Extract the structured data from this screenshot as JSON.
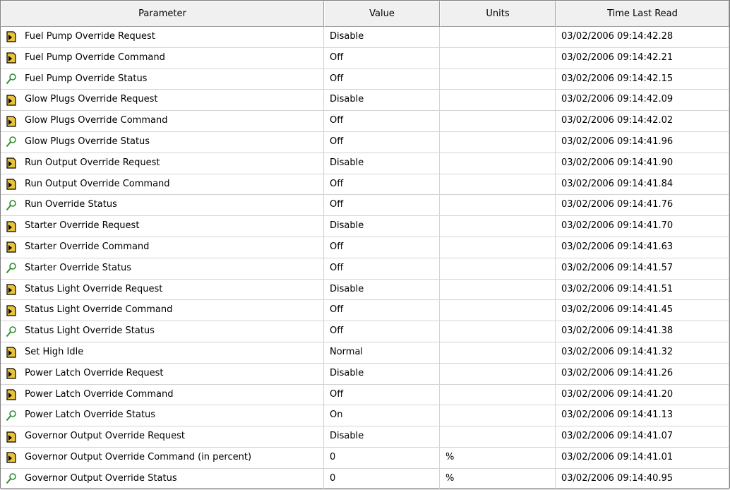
{
  "columns": {
    "parameter": "Parameter",
    "value": "Value",
    "units": "Units",
    "time": "Time Last Read"
  },
  "rows": [
    {
      "icon": "write-icon",
      "parameter": "Fuel Pump Override Request",
      "value": "Disable",
      "units": "",
      "time": "03/02/2006 09:14:42.28"
    },
    {
      "icon": "write-icon",
      "parameter": "Fuel Pump Override Command",
      "value": "Off",
      "units": "",
      "time": "03/02/2006 09:14:42.21"
    },
    {
      "icon": "read-icon",
      "parameter": "Fuel Pump Override Status",
      "value": "Off",
      "units": "",
      "time": "03/02/2006 09:14:42.15"
    },
    {
      "icon": "write-icon",
      "parameter": "Glow Plugs Override Request",
      "value": "Disable",
      "units": "",
      "time": "03/02/2006 09:14:42.09"
    },
    {
      "icon": "write-icon",
      "parameter": "Glow Plugs Override Command",
      "value": "Off",
      "units": "",
      "time": "03/02/2006 09:14:42.02"
    },
    {
      "icon": "read-icon",
      "parameter": "Glow Plugs Override Status",
      "value": "Off",
      "units": "",
      "time": "03/02/2006 09:14:41.96"
    },
    {
      "icon": "write-icon",
      "parameter": "Run Output Override Request",
      "value": "Disable",
      "units": "",
      "time": "03/02/2006 09:14:41.90"
    },
    {
      "icon": "write-icon",
      "parameter": "Run Output Override Command",
      "value": "Off",
      "units": "",
      "time": "03/02/2006 09:14:41.84"
    },
    {
      "icon": "read-icon",
      "parameter": "Run Override Status",
      "value": "Off",
      "units": "",
      "time": "03/02/2006 09:14:41.76"
    },
    {
      "icon": "write-icon",
      "parameter": "Starter Override Request",
      "value": "Disable",
      "units": "",
      "time": "03/02/2006 09:14:41.70"
    },
    {
      "icon": "write-icon",
      "parameter": "Starter Override Command",
      "value": "Off",
      "units": "",
      "time": "03/02/2006 09:14:41.63"
    },
    {
      "icon": "read-icon",
      "parameter": "Starter Override Status",
      "value": "Off",
      "units": "",
      "time": "03/02/2006 09:14:41.57"
    },
    {
      "icon": "write-icon",
      "parameter": "Status Light Override Request",
      "value": "Disable",
      "units": "",
      "time": "03/02/2006 09:14:41.51"
    },
    {
      "icon": "write-icon",
      "parameter": "Status Light Override Command",
      "value": "Off",
      "units": "",
      "time": "03/02/2006 09:14:41.45"
    },
    {
      "icon": "read-icon",
      "parameter": "Status Light Override Status",
      "value": "Off",
      "units": "",
      "time": "03/02/2006 09:14:41.38"
    },
    {
      "icon": "write-icon",
      "parameter": "Set High Idle",
      "value": "Normal",
      "units": "",
      "time": "03/02/2006 09:14:41.32"
    },
    {
      "icon": "write-icon",
      "parameter": "Power Latch Override Request",
      "value": "Disable",
      "units": "",
      "time": "03/02/2006 09:14:41.26"
    },
    {
      "icon": "write-icon",
      "parameter": "Power Latch Override Command",
      "value": "Off",
      "units": "",
      "time": "03/02/2006 09:14:41.20"
    },
    {
      "icon": "read-icon",
      "parameter": "Power Latch Override Status",
      "value": "On",
      "units": "",
      "time": "03/02/2006 09:14:41.13"
    },
    {
      "icon": "write-icon",
      "parameter": "Governor Output Override Request",
      "value": "Disable",
      "units": "",
      "time": "03/02/2006 09:14:41.07"
    },
    {
      "icon": "write-icon",
      "parameter": "Governor Output Override Command (in percent)",
      "value": "0",
      "units": "%",
      "time": "03/02/2006 09:14:41.01"
    },
    {
      "icon": "read-icon",
      "parameter": "Governor Output Override Status",
      "value": "0",
      "units": "%",
      "time": "03/02/2006 09:14:40.95"
    }
  ]
}
